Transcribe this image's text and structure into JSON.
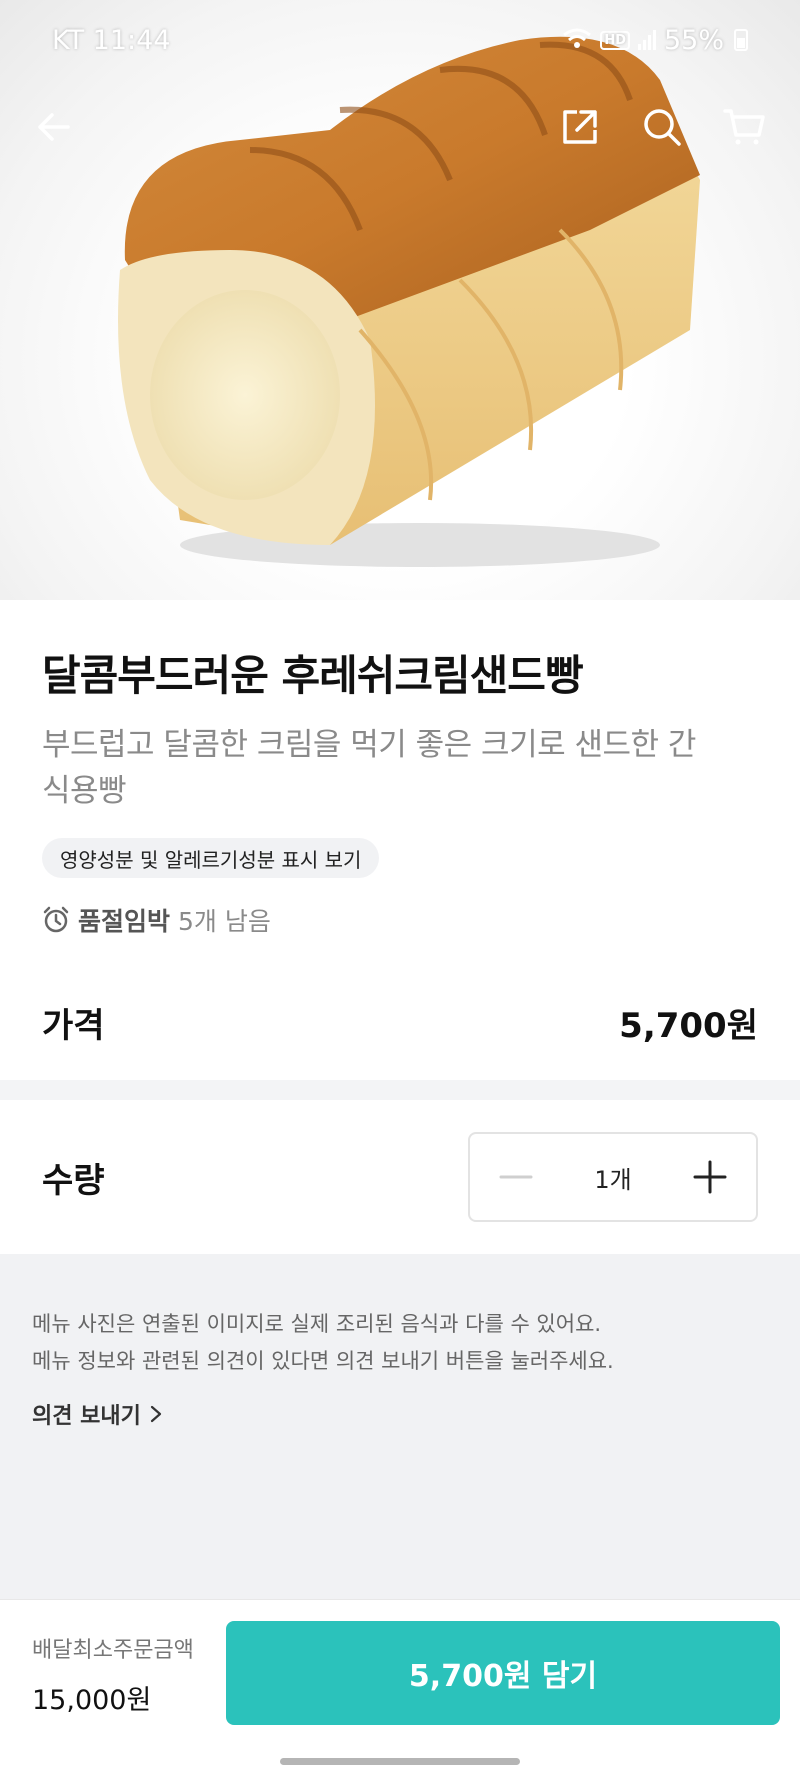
{
  "status_bar": {
    "carrier_time": "KT 11:44",
    "hd": "HD",
    "battery": "55%"
  },
  "nav": {
    "back_icon": "arrow-left-icon",
    "share_icon": "share-icon",
    "search_icon": "search-icon",
    "cart_icon": "cart-icon"
  },
  "product": {
    "title": "달콤부드러운 후레쉬크림샌드빵",
    "description": "부드럽고 달콤한 크림을 먹기 좋은 크기로 샌드한 간식용빵",
    "nutrition_button": "영양성분 및 알레르기성분 표시 보기",
    "stock_strong": "품절임박",
    "stock_text": "5개 남음",
    "price_label": "가격",
    "price_value": "5,700원"
  },
  "quantity": {
    "label": "수량",
    "value": "1개"
  },
  "notice": {
    "line1": "메뉴 사진은 연출된 이미지로 실제 조리된 음식과 다를 수 있어요.",
    "line2": "메뉴 정보와 관련된 의견이 있다면 의견 보내기 버튼을 눌러주세요.",
    "feedback_link": "의견 보내기"
  },
  "bottom": {
    "min_order_label": "배달최소주문금액",
    "min_order_value": "15,000원",
    "add_button": "5,700원 담기"
  },
  "colors": {
    "accent": "#2bc2bb",
    "muted_bg": "#f1f2f4"
  }
}
